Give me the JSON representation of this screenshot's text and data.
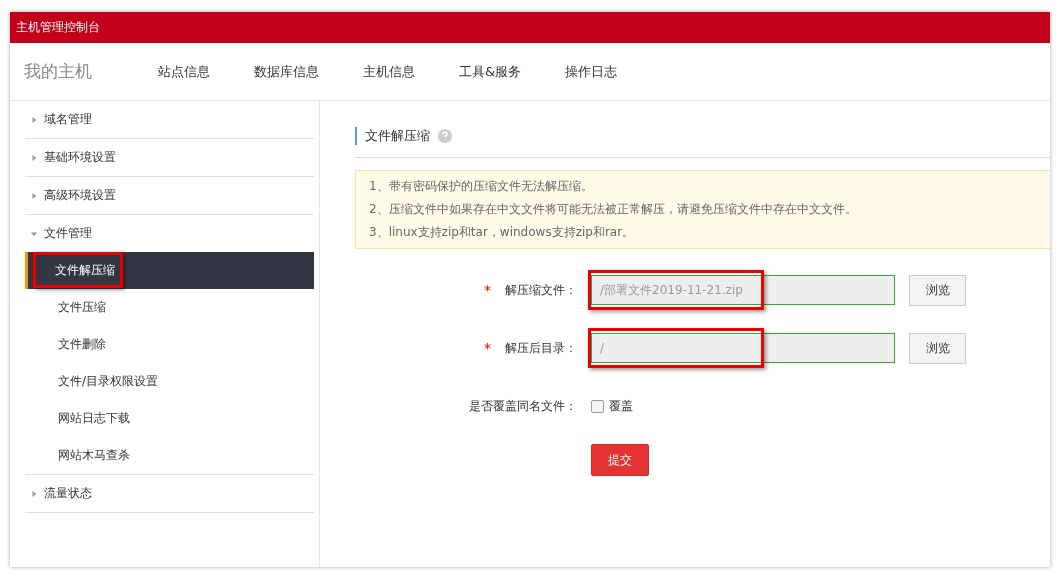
{
  "window": {
    "title": "主机管理控制台"
  },
  "required_mark": "*",
  "nav": {
    "brand": "我的主机",
    "items": [
      {
        "label": "站点信息",
        "selected": false
      },
      {
        "label": "数据库信息",
        "selected": false
      },
      {
        "label": "主机信息",
        "selected": false
      },
      {
        "label": "工具&服务",
        "selected": false
      },
      {
        "label": "操作日志",
        "selected": false
      }
    ]
  },
  "sidebar": {
    "groups": [
      {
        "label": "域名管理",
        "expanded": false
      },
      {
        "label": "基础环境设置",
        "expanded": false
      },
      {
        "label": "高级环境设置",
        "expanded": false
      },
      {
        "label": "文件管理",
        "expanded": true,
        "children": [
          {
            "label": "文件解压缩",
            "selected": true,
            "highlighted": true
          },
          {
            "label": "文件压缩",
            "selected": false,
            "highlighted": false
          },
          {
            "label": "文件删除",
            "selected": false,
            "highlighted": false
          },
          {
            "label": "文件/目录权限设置",
            "selected": false,
            "highlighted": false
          },
          {
            "label": "网站日志下载",
            "selected": false,
            "highlighted": false
          },
          {
            "label": "网站木马查杀",
            "selected": false,
            "highlighted": false
          }
        ]
      },
      {
        "label": "流量状态",
        "expanded": false
      }
    ]
  },
  "content": {
    "title": "文件解压缩",
    "notices": [
      "1、带有密码保护的压缩文件无法解压缩。",
      "2、压缩文件中如果存在中文文件将可能无法被正常解压，请避免压缩文件中存在中文文件。",
      "3、linux支持zip和tar，windows支持zip和rar。"
    ],
    "fields": [
      {
        "label": "解压缩文件：",
        "required": true,
        "value": "/部署文件2019-11-21.zip",
        "button": "浏览",
        "highlighted": true
      },
      {
        "label": "解压后目录：",
        "required": true,
        "value": "/",
        "button": "浏览",
        "highlighted": true
      }
    ],
    "overwrite": {
      "label": "是否覆盖同名文件：",
      "option": "覆盖",
      "checked": false
    },
    "submit": "提交"
  }
}
